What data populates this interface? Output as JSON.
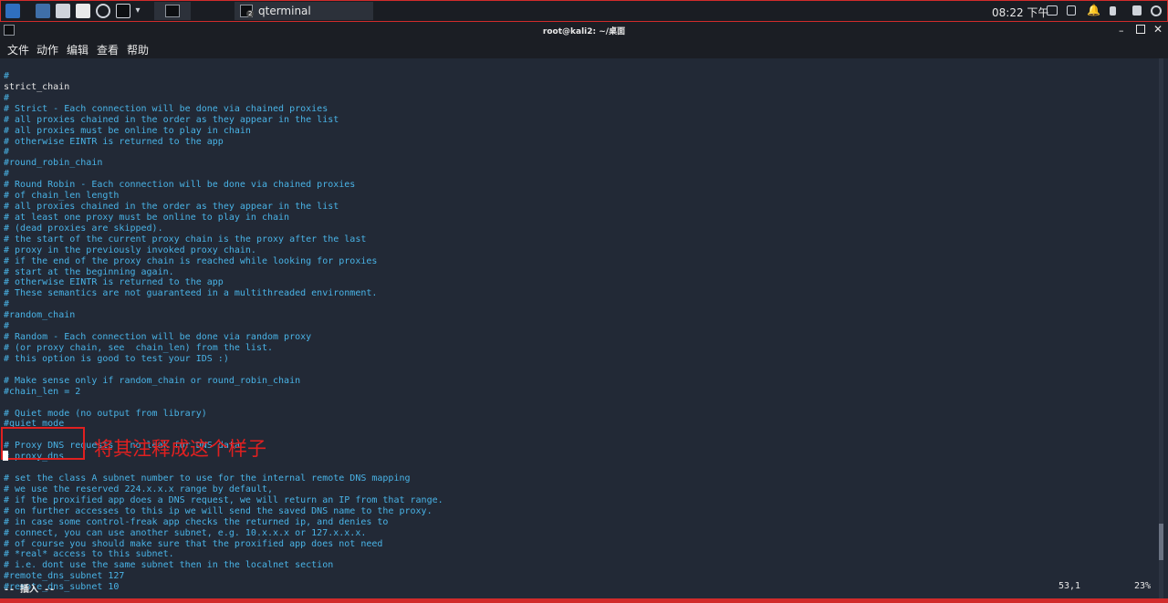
{
  "taskbar": {
    "window_title": "qterminal",
    "window_badge": "2",
    "clock": "08:22 下午"
  },
  "window": {
    "title": "root@kali2: ~/桌面"
  },
  "menu": [
    "文件",
    "动作",
    "编辑",
    "查看",
    "帮助"
  ],
  "lines": [
    {
      "t": "#",
      "k": "c"
    },
    {
      "t": "strict_chain",
      "k": "w"
    },
    {
      "t": "#",
      "k": "c"
    },
    {
      "t": "# Strict - Each connection will be done via chained proxies",
      "k": "c"
    },
    {
      "t": "# all proxies chained in the order as they appear in the list",
      "k": "c"
    },
    {
      "t": "# all proxies must be online to play in chain",
      "k": "c"
    },
    {
      "t": "# otherwise EINTR is returned to the app",
      "k": "c"
    },
    {
      "t": "#",
      "k": "c"
    },
    {
      "t": "#round_robin_chain",
      "k": "c"
    },
    {
      "t": "#",
      "k": "c"
    },
    {
      "t": "# Round Robin - Each connection will be done via chained proxies",
      "k": "c"
    },
    {
      "t": "# of chain_len length",
      "k": "c"
    },
    {
      "t": "# all proxies chained in the order as they appear in the list",
      "k": "c"
    },
    {
      "t": "# at least one proxy must be online to play in chain",
      "k": "c"
    },
    {
      "t": "# (dead proxies are skipped).",
      "k": "c"
    },
    {
      "t": "# the start of the current proxy chain is the proxy after the last",
      "k": "c"
    },
    {
      "t": "# proxy in the previously invoked proxy chain.",
      "k": "c"
    },
    {
      "t": "# if the end of the proxy chain is reached while looking for proxies",
      "k": "c"
    },
    {
      "t": "# start at the beginning again.",
      "k": "c"
    },
    {
      "t": "# otherwise EINTR is returned to the app",
      "k": "c"
    },
    {
      "t": "# These semantics are not guaranteed in a multithreaded environment.",
      "k": "c"
    },
    {
      "t": "#",
      "k": "c"
    },
    {
      "t": "#random_chain",
      "k": "c"
    },
    {
      "t": "#",
      "k": "c"
    },
    {
      "t": "# Random - Each connection will be done via random proxy",
      "k": "c"
    },
    {
      "t": "# (or proxy chain, see  chain_len) from the list.",
      "k": "c"
    },
    {
      "t": "# this option is good to test your IDS :)",
      "k": "c"
    },
    {
      "t": "",
      "k": "c"
    },
    {
      "t": "# Make sense only if random_chain or round_robin_chain",
      "k": "c"
    },
    {
      "t": "#chain_len = 2",
      "k": "c"
    },
    {
      "t": "",
      "k": "c"
    },
    {
      "t": "# Quiet mode (no output from library)",
      "k": "c"
    },
    {
      "t": "#quiet_mode",
      "k": "c"
    },
    {
      "t": "",
      "k": "c"
    },
    {
      "t": "# Proxy DNS requests - no leak for DNS data",
      "k": "c"
    },
    {
      "t": "# proxy_dns",
      "k": "c"
    },
    {
      "t": "",
      "k": "c"
    },
    {
      "t": "# set the class A subnet number to use for the internal remote DNS mapping",
      "k": "c"
    },
    {
      "t": "# we use the reserved 224.x.x.x range by default,",
      "k": "c"
    },
    {
      "t": "# if the proxified app does a DNS request, we will return an IP from that range.",
      "k": "c"
    },
    {
      "t": "# on further accesses to this ip we will send the saved DNS name to the proxy.",
      "k": "c"
    },
    {
      "t": "# in case some control-freak app checks the returned ip, and denies to",
      "k": "c"
    },
    {
      "t": "# connect, you can use another subnet, e.g. 10.x.x.x or 127.x.x.x.",
      "k": "c"
    },
    {
      "t": "# of course you should make sure that the proxified app does not need",
      "k": "c"
    },
    {
      "t": "# *real* access to this subnet.",
      "k": "c"
    },
    {
      "t": "# i.e. dont use the same subnet then in the localnet section",
      "k": "c"
    },
    {
      "t": "#remote_dns_subnet 127",
      "k": "c"
    },
    {
      "t": "#remote_dns_subnet 10",
      "k": "c"
    }
  ],
  "annotation": {
    "text": "将其注释成这个样子",
    "color": "#e02020"
  },
  "status": {
    "mode": "-- 插入 --",
    "position": "53,1",
    "percent": "23%"
  },
  "colors": {
    "comment": "#49b3e6",
    "code": "#e6e6e6",
    "background": "#222936",
    "highlight": "#d12b2b"
  }
}
